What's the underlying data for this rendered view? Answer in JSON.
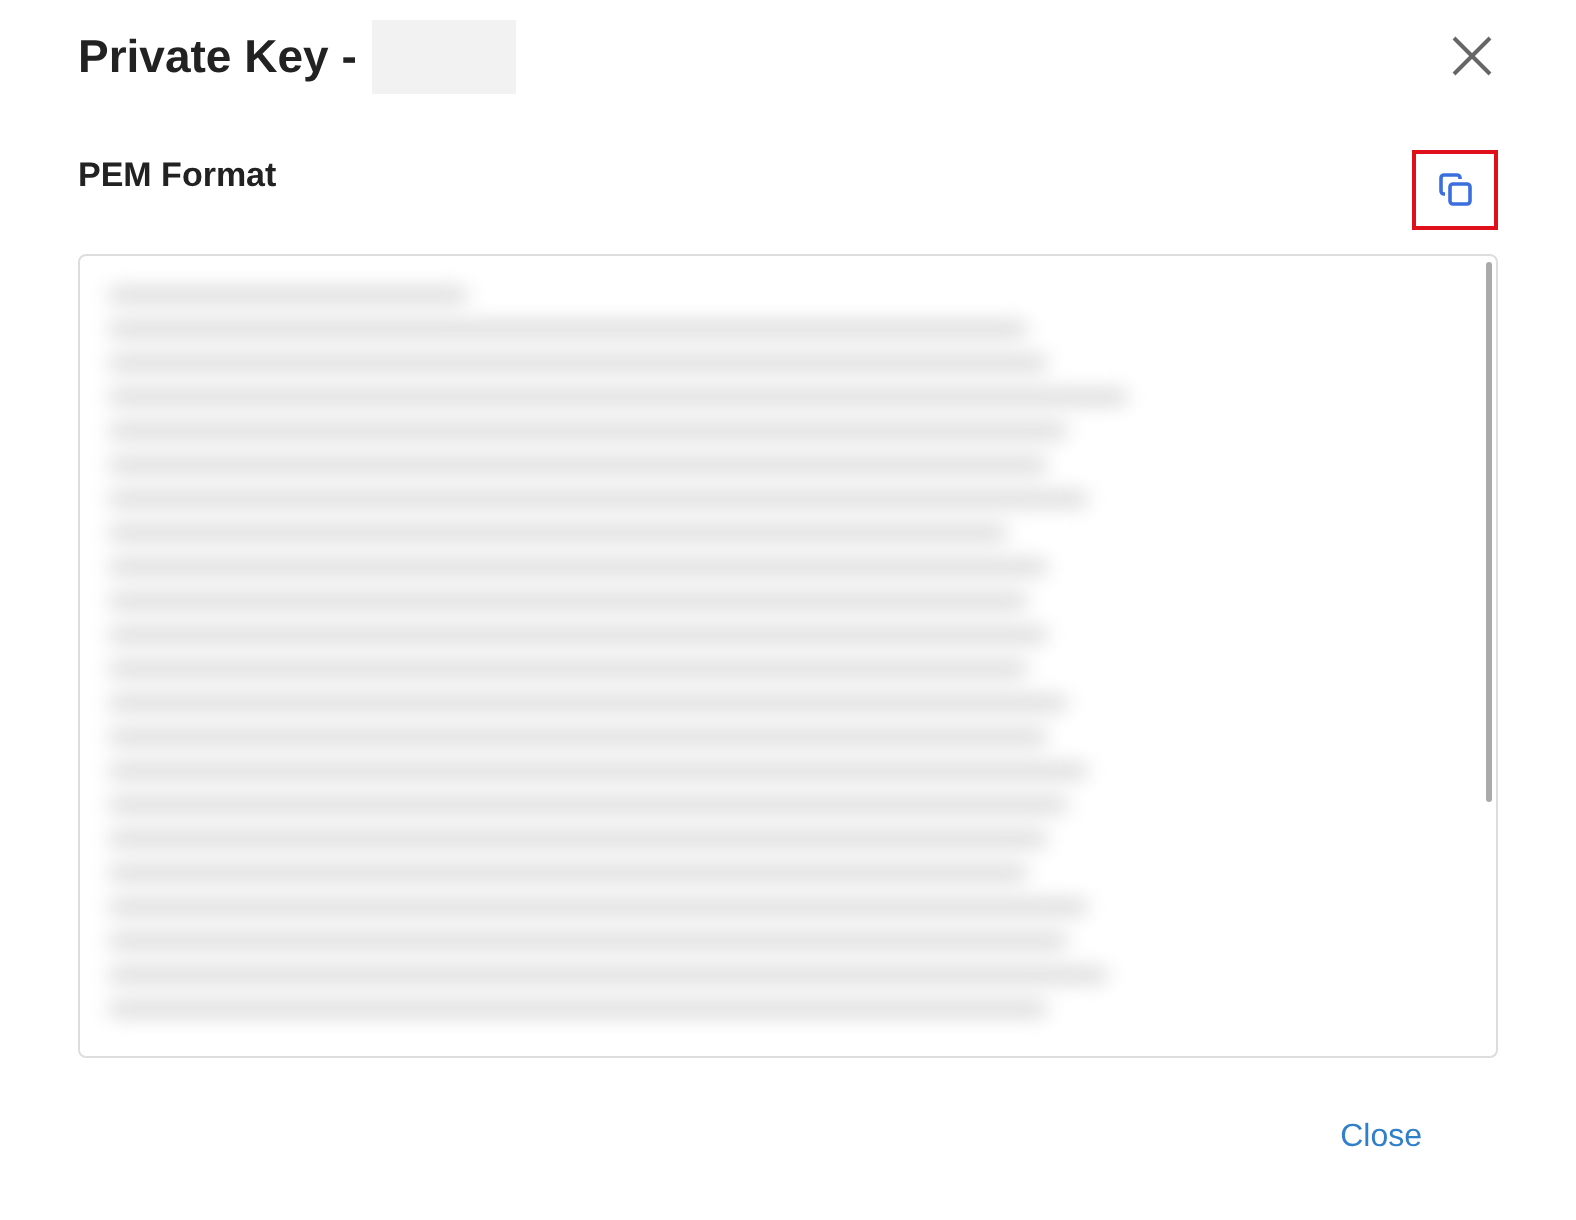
{
  "dialog": {
    "title": "Private Key -",
    "section_label": "PEM Format",
    "copy_button": {
      "highlighted": true
    },
    "key_field": {
      "kind": "redacted"
    },
    "buttons": [
      "Close"
    ]
  }
}
